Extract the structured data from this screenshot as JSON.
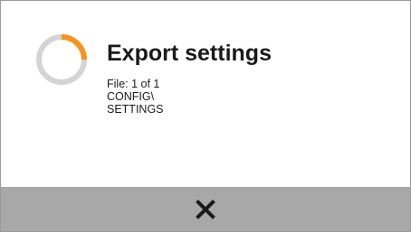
{
  "dialog": {
    "title": "Export settings",
    "file_progress": "File: 1 of 1",
    "path_line1": "CONFIG\\",
    "path_line2": "SETTINGS"
  },
  "progress": {
    "fraction": 0.25,
    "track_color": "#d4d4d4",
    "accent_color": "#f7941d"
  },
  "footer": {
    "background_color": "#a8a8a8",
    "close_icon": "close-icon"
  }
}
